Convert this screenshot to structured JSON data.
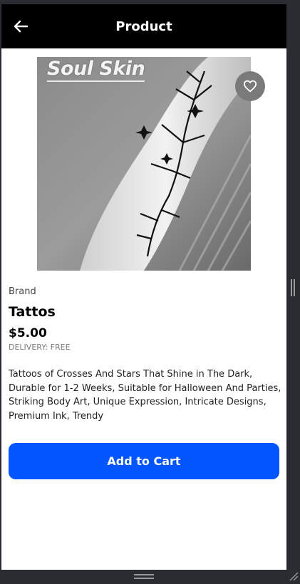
{
  "header": {
    "title": "Product",
    "back_icon": "arrow-left-icon"
  },
  "product": {
    "image_watermark": "Soul Skin",
    "favorite_icon": "heart-outline-icon",
    "brand": "Brand",
    "name": "Tattos",
    "price": "$5.00",
    "delivery": "DELIVERY: FREE",
    "description": "Tattoos of Crosses And Stars That Shine in The Dark, Durable for 1-2 Weeks, Suitable for Halloween And Parties, Striking Body Art, Unique Expression, Intricate Designs, Premium Ink, Trendy"
  },
  "actions": {
    "add_to_cart_label": "Add to Cart"
  },
  "colors": {
    "header_bg": "#000000",
    "accent": "#0356ff",
    "window_chrome": "#2b2c31"
  }
}
